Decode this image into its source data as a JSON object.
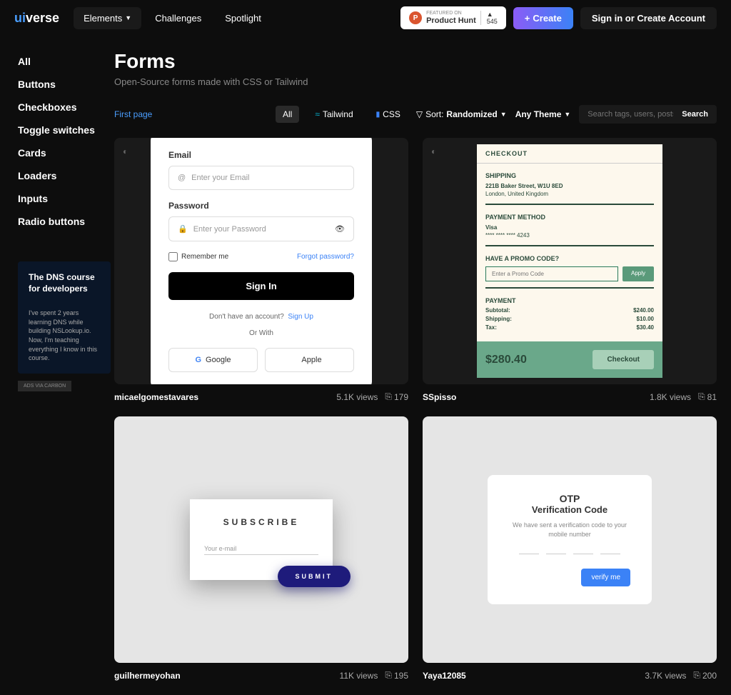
{
  "header": {
    "logo_ui": "ui",
    "logo_verse": "verse",
    "nav": [
      "Elements",
      "Challenges",
      "Spotlight"
    ],
    "product_hunt": {
      "sub": "FEATURED ON",
      "main": "Product Hunt",
      "count": "545"
    },
    "create": "Create",
    "signin": "Sign in or Create Account"
  },
  "sidebar": {
    "items": [
      "All",
      "Buttons",
      "Checkboxes",
      "Toggle switches",
      "Cards",
      "Loaders",
      "Inputs",
      "Radio buttons"
    ],
    "ad": {
      "title": "The DNS course for developers",
      "desc": "I've spent 2 years learning DNS while building NSLookup.io. Now, I'm teaching everything I know in this course.",
      "tag": "ADS VIA CARBON"
    }
  },
  "page": {
    "title": "Forms",
    "subtitle": "Open-Source forms made with CSS or Tailwind"
  },
  "filters": {
    "first_page": "First page",
    "all": "All",
    "tailwind": "Tailwind",
    "css": "CSS",
    "sort_label": "Sort:",
    "sort_value": "Randomized",
    "theme": "Any Theme",
    "search_placeholder": "Search tags, users, posts...",
    "search_btn": "Search"
  },
  "cards": [
    {
      "author": "micaelgomestavares",
      "views": "5.1K views",
      "bookmarks": "179"
    },
    {
      "author": "SSpisso",
      "views": "1.8K views",
      "bookmarks": "81"
    },
    {
      "author": "guilhermeyohan",
      "views": "11K views",
      "bookmarks": "195"
    },
    {
      "author": "Yaya12085",
      "views": "3.7K views",
      "bookmarks": "200"
    }
  ],
  "login": {
    "email_label": "Email",
    "email_placeholder": "Enter your Email",
    "password_label": "Password",
    "password_placeholder": "Enter your Password",
    "remember": "Remember me",
    "forgot": "Forgot password?",
    "signin": "Sign In",
    "signup_text": "Don't have an account?",
    "signup_link": "Sign Up",
    "or_with": "Or With",
    "google": "Google",
    "apple": "Apple"
  },
  "checkout": {
    "title": "CHECKOUT",
    "shipping_title": "SHIPPING",
    "shipping_addr1": "221B Baker Street, W1U 8ED",
    "shipping_addr2": "London, United Kingdom",
    "payment_title": "PAYMENT METHOD",
    "payment_card": "Visa",
    "payment_num": "**** **** **** 4243",
    "promo_title": "HAVE A PROMO CODE?",
    "promo_placeholder": "Enter a Promo Code",
    "apply": "Apply",
    "payment_section": "PAYMENT",
    "subtotal_label": "Subtotal:",
    "subtotal_val": "$240.00",
    "shipping_label": "Shipping:",
    "shipping_val": "$10.00",
    "tax_label": "Tax:",
    "tax_val": "$30.40",
    "total": "$280.40",
    "checkout_btn": "Checkout"
  },
  "subscribe": {
    "title": "SUBSCRIBE",
    "placeholder": "Your e-mail",
    "submit": "SUBMIT"
  },
  "otp": {
    "title": "OTP",
    "subtitle": "Verification Code",
    "desc": "We have sent a verification code to your mobile number",
    "verify": "verify me"
  }
}
